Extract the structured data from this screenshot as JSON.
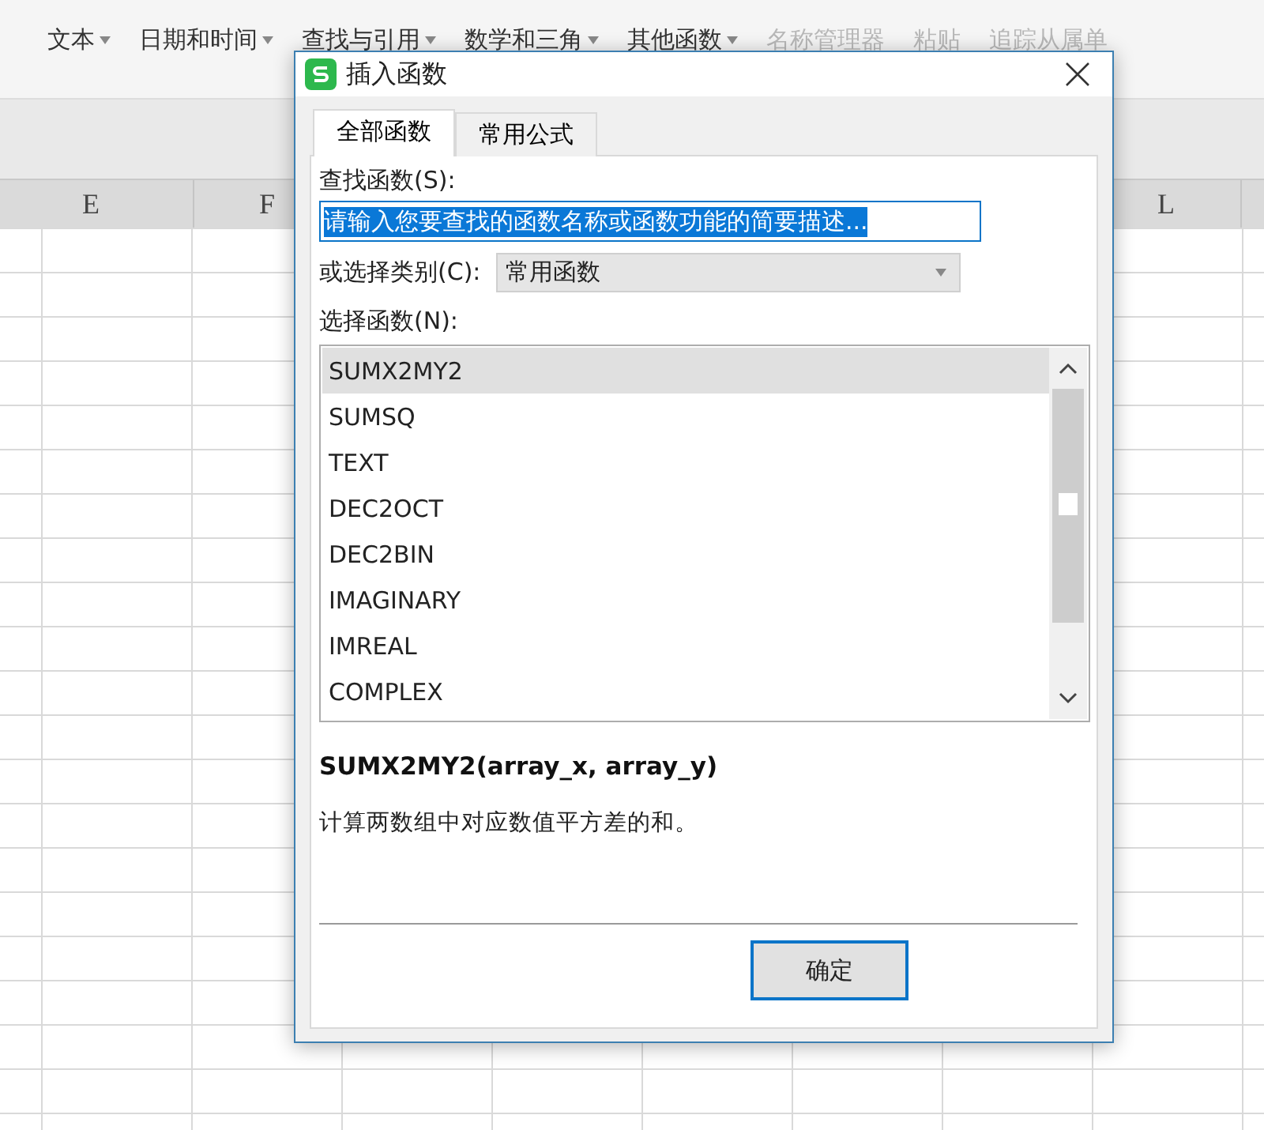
{
  "ribbon": {
    "items": [
      {
        "label": "文本",
        "disabled": false
      },
      {
        "label": "日期和时间",
        "disabled": false
      },
      {
        "label": "查找与引用",
        "disabled": false
      },
      {
        "label": "数学和三角",
        "disabled": false
      },
      {
        "label": "其他函数",
        "disabled": false
      },
      {
        "label": "名称管理器",
        "disabled": true
      },
      {
        "label": "粘贴",
        "disabled": true
      },
      {
        "label": "追踪从属单",
        "disabled": true
      }
    ]
  },
  "sheet": {
    "columns": [
      "E",
      "F",
      "L"
    ]
  },
  "dialog": {
    "title": "插入函数",
    "tabs": [
      {
        "label": "全部函数",
        "selected": true
      },
      {
        "label": "常用公式",
        "selected": false
      }
    ],
    "search": {
      "label": "查找函数(S):",
      "value": "请输入您要查找的函数名称或函数功能的简要描述...",
      "highlighted": true
    },
    "category": {
      "label": "或选择类别(C):",
      "value": "常用函数"
    },
    "functions": {
      "label": "选择函数(N):",
      "items": [
        {
          "name": "SUMX2MY2",
          "selected": true
        },
        {
          "name": "SUMSQ",
          "selected": false
        },
        {
          "name": "TEXT",
          "selected": false
        },
        {
          "name": "DEC2OCT",
          "selected": false
        },
        {
          "name": "DEC2BIN",
          "selected": false
        },
        {
          "name": "IMAGINARY",
          "selected": false
        },
        {
          "name": "IMREAL",
          "selected": false
        },
        {
          "name": "COMPLEX",
          "selected": false
        }
      ]
    },
    "signature": "SUMX2MY2(array_x, array_y)",
    "description": "计算两数组中对应数值平方差的和。",
    "buttons": [
      "确定"
    ]
  }
}
